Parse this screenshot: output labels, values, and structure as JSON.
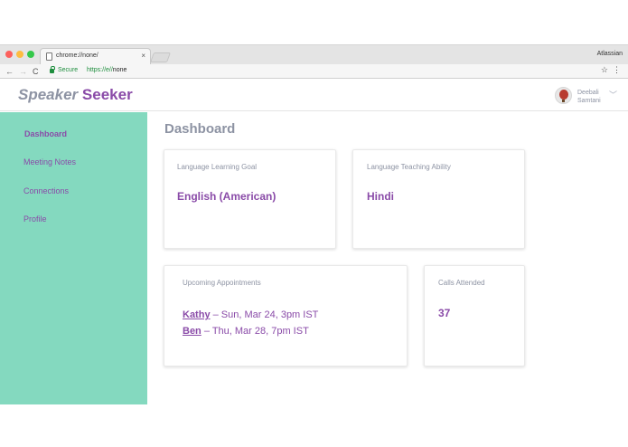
{
  "browser": {
    "tab_title": "chrome://none/",
    "tab_close": "×",
    "account": "Atlassian",
    "secure_label": "Secure",
    "url_scheme": "https://e//",
    "url_rest": "none",
    "back_icon": "←",
    "forward_icon": "→",
    "reload_icon": "C",
    "star_icon": "☆",
    "menu_icon": "⋮"
  },
  "app": {
    "logo_part1": "Speaker",
    "logo_part2": "Seeker",
    "user_first": "Deebali",
    "user_last": "Samtani",
    "user_menu_icon": "﹀"
  },
  "sidebar": {
    "items": [
      {
        "label": "Dashboard",
        "active": true
      },
      {
        "label": "Meeting Notes",
        "active": false
      },
      {
        "label": "Connections",
        "active": false
      },
      {
        "label": "Profile",
        "active": false
      }
    ]
  },
  "main": {
    "title": "Dashboard",
    "learning_goal": {
      "label": "Language Learning Goal",
      "value": "English (American)"
    },
    "teaching_ability": {
      "label": "Language Teaching Ability",
      "value": "Hindi"
    },
    "appointments": {
      "label": "Upcoming Appointments",
      "items": [
        {
          "name": "Kathy",
          "detail": " – Sun, Mar 24, 3pm IST"
        },
        {
          "name": "Ben",
          "detail": " – Thu, Mar 28, 7pm IST"
        }
      ]
    },
    "calls": {
      "label": "Calls Attended",
      "value": "37"
    }
  },
  "colors": {
    "accent_purple": "#8a4ba8",
    "sidebar_mint": "#84d9bf",
    "muted_gray": "#8d93a3"
  }
}
